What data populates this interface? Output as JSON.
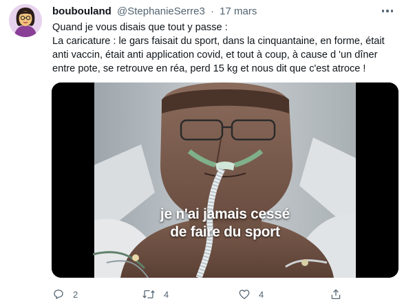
{
  "tweet": {
    "author_name": "boubouland",
    "handle": "@StephanieSerre3",
    "separator": "·",
    "date": "17 mars",
    "text_lines": [
      "Quand je vous disais que tout y passe :",
      "La caricature : le gars faisait du sport, dans la cinquantaine, en forme, était",
      "anti vaccin, était anti application covid, et tout à coup, à cause d 'un dîner",
      "entre pote, se retrouve en réa, perd 15 kg et nous dit que c'est atroce !"
    ],
    "video_caption": [
      "je n'ai jamais cessé",
      "de faire du sport"
    ]
  },
  "actions": {
    "reply_count": "2",
    "retweet_count": "4",
    "like_count": "4"
  },
  "icons": [
    "avatar",
    "more-icon",
    "reply-icon",
    "retweet-icon",
    "like-icon",
    "share-icon"
  ],
  "colors": {
    "text": "#0f1419",
    "muted": "#536471",
    "background": "#ffffff"
  }
}
